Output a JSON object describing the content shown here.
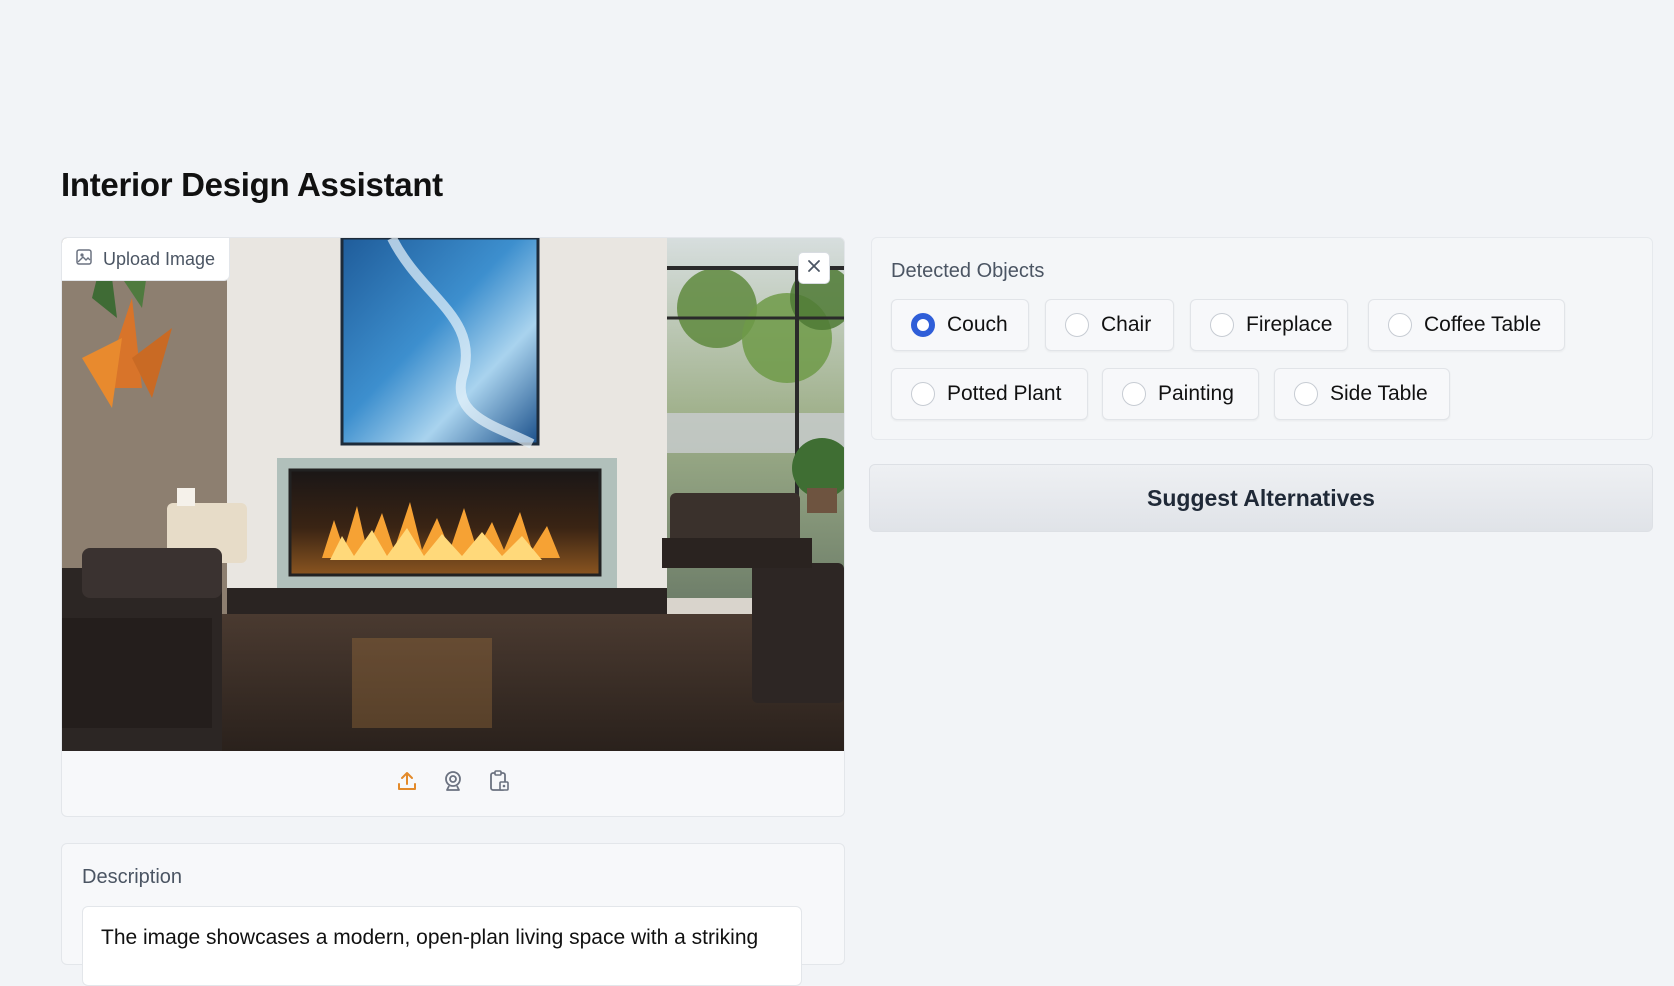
{
  "page": {
    "title": "Interior Design Assistant"
  },
  "image_panel": {
    "label": "Upload Image",
    "label_icon": "image-icon",
    "close_icon": "close-icon",
    "source_buttons": [
      {
        "icon": "upload-icon",
        "color": "#e38a2a"
      },
      {
        "icon": "webcam-icon",
        "color": "#6b7280"
      },
      {
        "icon": "clipboard-icon",
        "color": "#6b7280"
      }
    ]
  },
  "description": {
    "label": "Description",
    "text": "The image showcases a modern, open-plan living space with a striking"
  },
  "detected_objects": {
    "label": "Detected Objects",
    "selected": "Couch",
    "options": [
      "Couch",
      "Chair",
      "Fireplace",
      "Coffee Table",
      "Potted Plant",
      "Painting",
      "Side Table"
    ]
  },
  "actions": {
    "suggest_label": "Suggest Alternatives"
  },
  "colors": {
    "accent": "#2f5ed8",
    "upload_accent": "#e38a2a",
    "background": "#f2f4f7"
  }
}
